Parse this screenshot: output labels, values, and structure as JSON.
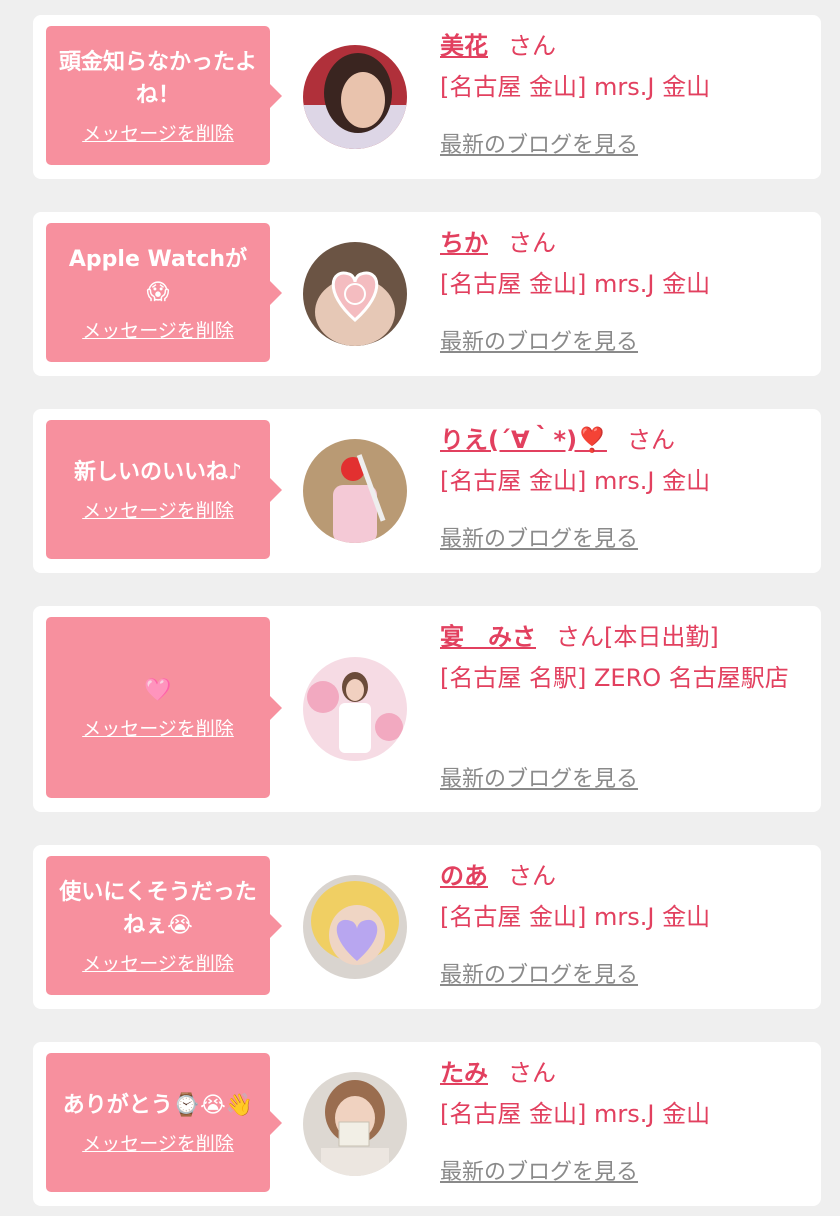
{
  "entries": [
    {
      "message": "頭金知らなかったよね！",
      "delete_label": "メッセージを削除",
      "name": "美花",
      "suffix": "さん",
      "shop": "[名古屋 金山] mrs.J 金山",
      "blog_link": "最新のブログを見る"
    },
    {
      "message": "Apple Watchが😱",
      "delete_label": "メッセージを削除",
      "name": "ちか",
      "suffix": "さん",
      "shop": "[名古屋 金山] mrs.J 金山",
      "blog_link": "最新のブログを見る"
    },
    {
      "message": "新しいのいいね♪",
      "delete_label": "メッセージを削除",
      "name": "りえ(´∀｀*)❣️",
      "suffix": "さん",
      "shop": "[名古屋 金山] mrs.J 金山",
      "blog_link": "最新のブログを見る"
    },
    {
      "message": "🩷",
      "delete_label": "メッセージを削除",
      "name": "宴　みさ",
      "suffix": "さん[本日出勤]",
      "shop": "[名古屋 名駅] ZERO 名古屋駅店",
      "blog_link": "最新のブログを見る"
    },
    {
      "message": "使いにくそうだったねぇ😭",
      "delete_label": "メッセージを削除",
      "name": "のあ",
      "suffix": "さん",
      "shop": "[名古屋 金山] mrs.J 金山",
      "blog_link": "最新のブログを見る"
    },
    {
      "message": "ありがとう⌚️😭👋",
      "delete_label": "メッセージを削除",
      "name": "たみ",
      "suffix": "さん",
      "shop": "[名古屋 金山] mrs.J 金山",
      "blog_link": "最新のブログを見る"
    }
  ],
  "colors": {
    "accent": "#e2405f",
    "bubble": "#f7909e",
    "link_gray": "#8a8a8a",
    "background": "#efefef"
  }
}
